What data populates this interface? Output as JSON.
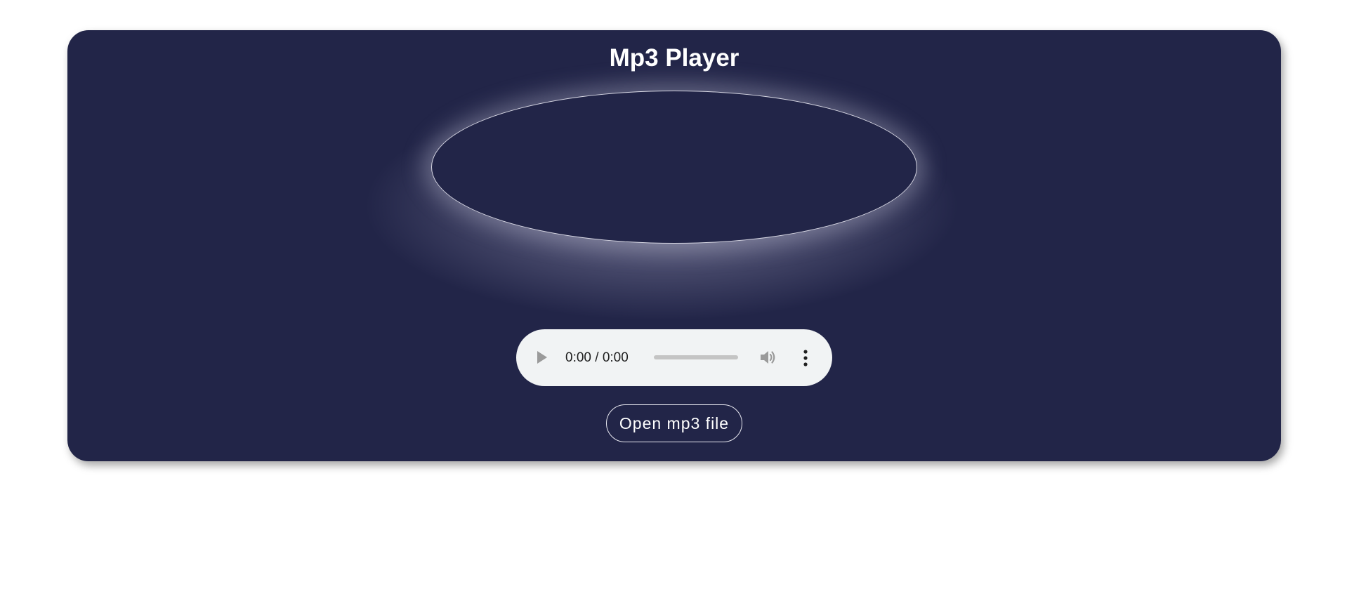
{
  "app": {
    "title": "Mp3 Player"
  },
  "audio": {
    "time_display": "0:00 / 0:00",
    "progress": 0,
    "play_icon": "play-icon",
    "volume_icon": "volume-icon",
    "more_icon": "more-options-icon"
  },
  "controls": {
    "open_label": "Open mp3 file"
  },
  "colors": {
    "card_background": "#222548",
    "control_background": "#f1f3f4",
    "text": "#ffffff"
  }
}
